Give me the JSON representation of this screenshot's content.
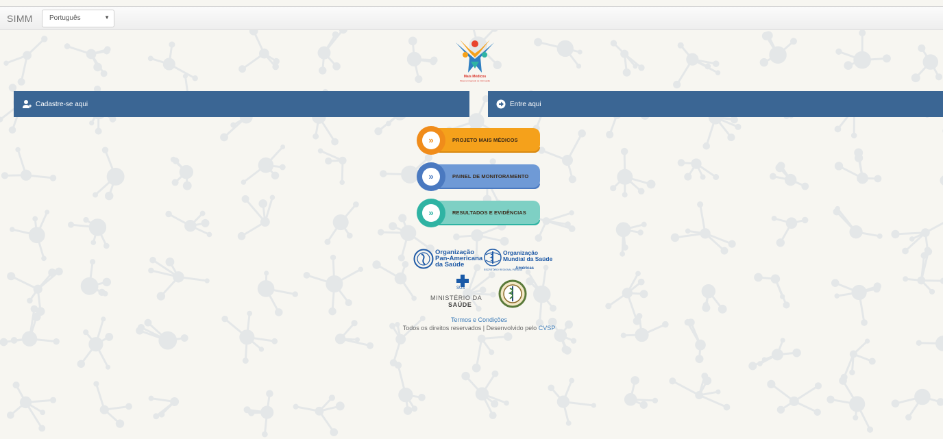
{
  "navbar": {
    "brand": "SIMM",
    "language": {
      "selected": "Português"
    }
  },
  "logo": {
    "title": "Mais Médicos",
    "subtitle": "Sistema Integrado de Informação"
  },
  "bars": {
    "register_label": "Cadastre-se aqui",
    "login_label": "Entre aqui"
  },
  "menu": [
    {
      "label": "PROJETO MAIS MÉDICOS",
      "color": "#f5a11b",
      "ring": "#f08c1a"
    },
    {
      "label": "PAINEL DE MONITORAMENTO",
      "color": "#6f9ad6",
      "ring": "#4a79c0"
    },
    {
      "label": "RESULTADOS E EVIDÊNCIAS",
      "color": "#7ed0c4",
      "ring": "#2fb3a3"
    }
  ],
  "partners": {
    "paho": {
      "line1": "Organização",
      "line2": "Pan-Americana",
      "line3": "da Saúde"
    },
    "who": {
      "line1": "Organização",
      "line2": "Mundial da Saúde",
      "sub": "ESCRITÓRIO REGIONAL PARA AS",
      "americas": "Américas"
    },
    "ministry": {
      "sus": "SUS",
      "line1": "MINISTÉRIO DA",
      "line2": "SAÚDE"
    }
  },
  "footer": {
    "terms": "Termos e Condições",
    "rights": "Todos os direitos reservados | Desenvolvido pelo",
    "developer": "CVSP"
  }
}
